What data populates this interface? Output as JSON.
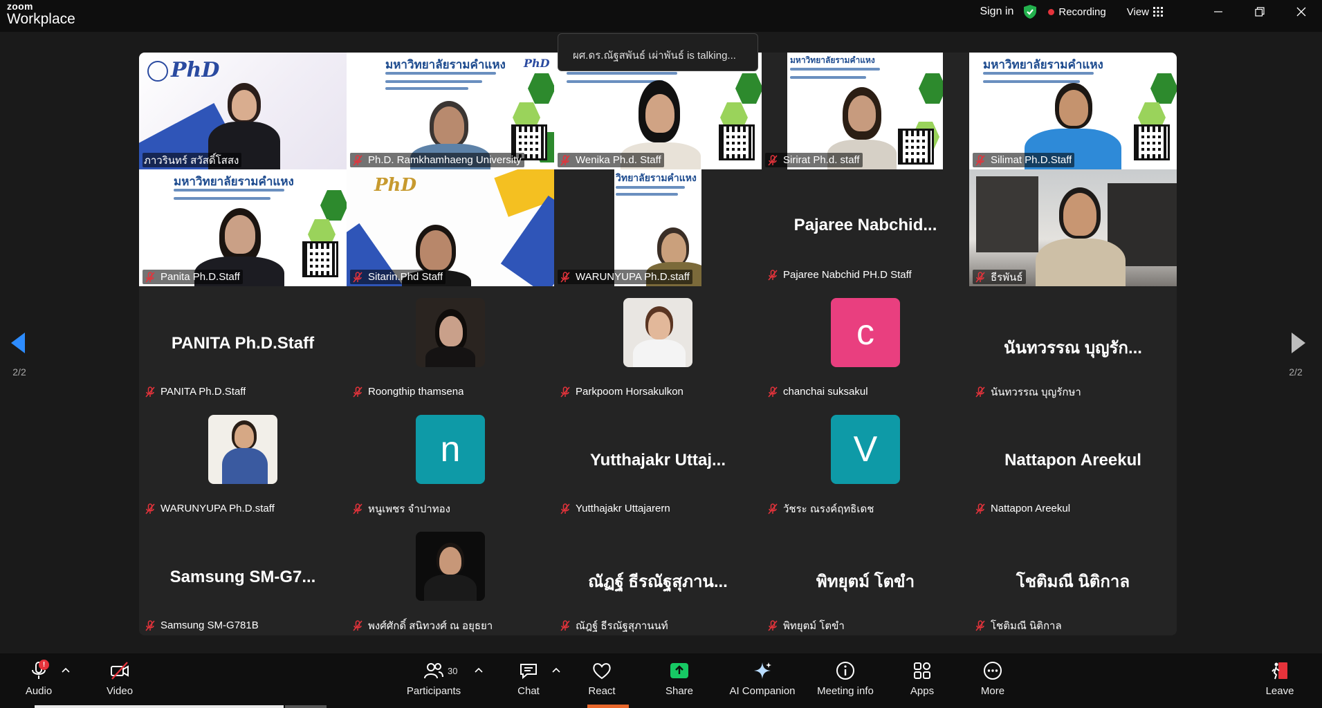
{
  "app": {
    "logo_top": "zoom",
    "logo_bottom": "Workplace"
  },
  "titlebar": {
    "sign_in": "Sign in",
    "recording": "Recording",
    "view": "View"
  },
  "toast": "ผศ.ดร.ณัฐสพันธ์ เผ่าพันธ์ is talking...",
  "pager": {
    "left": "2/2",
    "right": "2/2"
  },
  "colors": {
    "accent_blue": "#0b5cff",
    "mute_red": "#e5333b",
    "share_green": "#17c964",
    "avatar_pink": "#e93f7f",
    "avatar_teal": "#0e9aa7"
  },
  "tiles": [
    {
      "name": "ภาวรินทร์ สวัสดิ์โสสง",
      "kind": "video",
      "muted": false
    },
    {
      "name": "Ph.D. Ramkhamhaeng University",
      "kind": "video",
      "muted": true
    },
    {
      "name": "Wenika Ph.d. Staff",
      "kind": "video",
      "muted": true
    },
    {
      "name": "Sirirat Ph.d. staff",
      "kind": "video",
      "muted": true
    },
    {
      "name": "Silimat Ph.D.Staff",
      "kind": "video",
      "muted": true
    },
    {
      "name": "Panita Ph.D.Staff",
      "kind": "video",
      "muted": true
    },
    {
      "name": "Sitarin.Phd Staff",
      "kind": "video",
      "muted": true
    },
    {
      "name": "WARUNYUPA Ph.D.staff",
      "kind": "video",
      "muted": true
    },
    {
      "name": "Pajaree Nabchid PH.D Staff",
      "display": "Pajaree  Nabchid...",
      "kind": "name",
      "muted": true
    },
    {
      "name": "ธีรพันธ์",
      "kind": "video",
      "muted": true
    },
    {
      "name": "PANITA Ph.D.Staff",
      "display": "PANITA Ph.D.Staff",
      "kind": "name",
      "muted": true
    },
    {
      "name": "Roongthip thamsena",
      "kind": "photo",
      "muted": true
    },
    {
      "name": "Parkpoom Horsakulkon",
      "kind": "photo",
      "muted": true
    },
    {
      "name": "chanchai suksakul",
      "letter": "c",
      "kind": "letter",
      "muted": true
    },
    {
      "name": "นันทวรรณ บุญรักษา",
      "display": "นันทวรรณ บุญรัก...",
      "kind": "name",
      "muted": true
    },
    {
      "name": "WARUNYUPA Ph.D.staff",
      "kind": "photo",
      "muted": true
    },
    {
      "name": "หนูเพชร จำปาทอง",
      "letter": "n",
      "kind": "letter",
      "muted": true
    },
    {
      "name": "Yutthajakr Uttajarern",
      "display": "Yutthajakr  Uttaj...",
      "kind": "name",
      "muted": true
    },
    {
      "name": "วัชระ ณรงค์ฤทธิเดช",
      "letter": "V",
      "kind": "letter",
      "muted": true
    },
    {
      "name": "Nattapon Areekul",
      "display": "Nattapon Areekul",
      "kind": "name",
      "muted": true
    },
    {
      "name": "Samsung SM-G781B",
      "display": "Samsung  SM-G7...",
      "kind": "name",
      "muted": true
    },
    {
      "name": "พงศ์ศักดิ์ สนิทวงศ์ ณ อยุธยา",
      "kind": "photo",
      "muted": true
    },
    {
      "name": "ณัฎฐ์ ธีรณัฐสุภานนท์",
      "display": "ณัฏฐ์  ธีรณัฐสุภาน...",
      "kind": "name",
      "muted": true
    },
    {
      "name": "พิทยุตม์ โตขำ",
      "display": "พิทยุตม์  โตขำ",
      "kind": "name",
      "muted": true
    },
    {
      "name": "โชติมณี นิติกาล",
      "display": "โชติมณี นิติกาล",
      "kind": "name",
      "muted": true
    }
  ],
  "banner": {
    "thai_title": "มหาวิทยาลัยรามคำแหง",
    "phd": "PhD"
  },
  "toolbar": {
    "audio": "Audio",
    "audio_notif": "!",
    "video": "Video",
    "participants": "Participants",
    "participants_count": "30",
    "chat": "Chat",
    "react": "React",
    "share": "Share",
    "ai_companion": "AI Companion",
    "meeting_info": "Meeting info",
    "apps": "Apps",
    "more": "More",
    "leave": "Leave"
  }
}
